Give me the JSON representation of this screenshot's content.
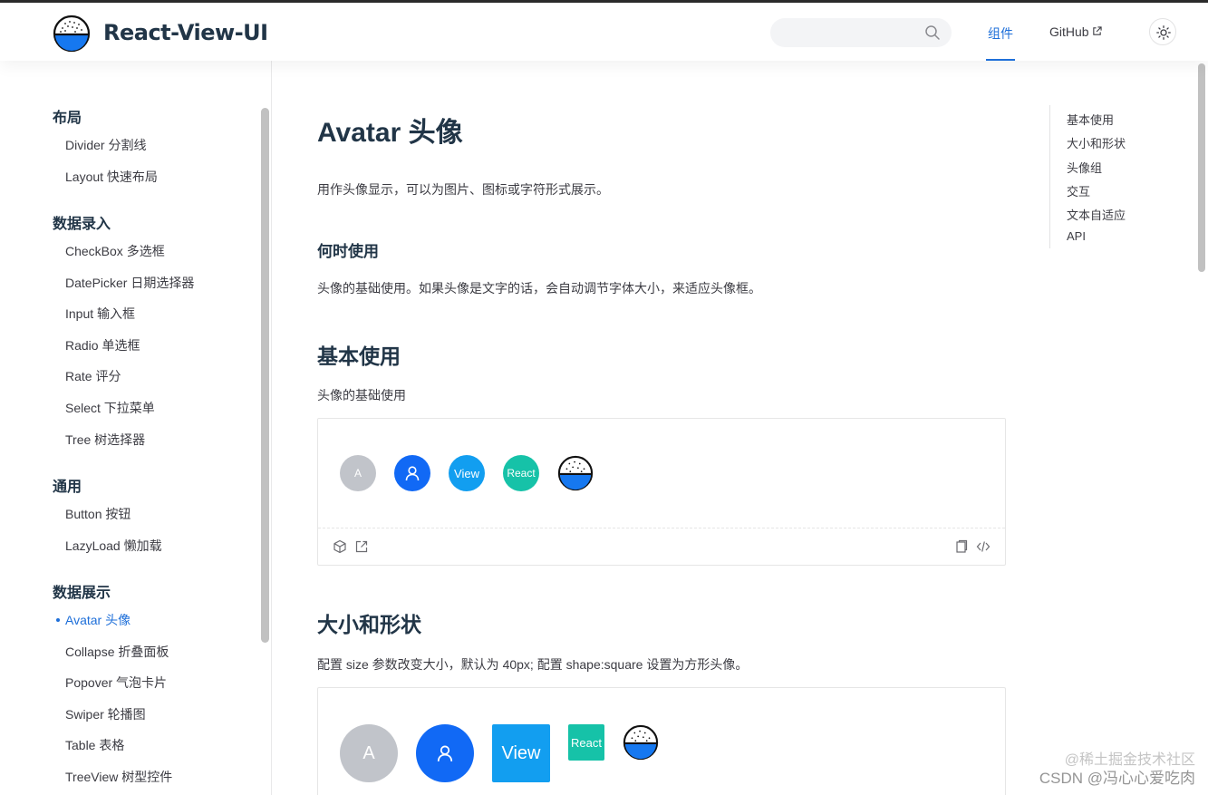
{
  "header": {
    "brand": "React-View-UI",
    "search_placeholder": "",
    "nav": {
      "components": "组件",
      "github": "GitHub"
    }
  },
  "sidebar": {
    "groups": [
      {
        "title": "布局",
        "items": [
          "Divider 分割线",
          "Layout 快速布局"
        ]
      },
      {
        "title": "数据录入",
        "items": [
          "CheckBox 多选框",
          "DatePicker 日期选择器",
          "Input 输入框",
          "Radio 单选框",
          "Rate 评分",
          "Select 下拉菜单",
          "Tree 树选择器"
        ]
      },
      {
        "title": "通用",
        "items": [
          "Button 按钮",
          "LazyLoad 懒加载"
        ]
      },
      {
        "title": "数据展示",
        "items": [
          "Avatar 头像",
          "Collapse 折叠面板",
          "Popover 气泡卡片",
          "Swiper 轮播图",
          "Table 表格",
          "TreeView 树型控件"
        ]
      }
    ],
    "active": "Avatar 头像"
  },
  "main": {
    "title": "Avatar 头像",
    "intro": "用作头像显示，可以为图片、图标或字符形式展示。",
    "when_heading": "何时使用",
    "when_text": "头像的基础使用。如果头像是文字的话，会自动调节字体大小，来适应头像框。",
    "section1": {
      "heading": "基本使用",
      "desc": "头像的基础使用",
      "avatars": {
        "letter": "A",
        "view": "View",
        "react": "React"
      }
    },
    "section2": {
      "heading": "大小和形状",
      "desc": "配置 size 参数改变大小，默认为 40px; 配置 shape:square 设置为方形头像。",
      "avatars": {
        "letter": "A",
        "view": "View",
        "react": "React"
      }
    }
  },
  "toc": [
    "基本使用",
    "大小和形状",
    "头像组",
    "交互",
    "文本自适应",
    "API"
  ],
  "watermark": {
    "top": "@稀土掘金技术社区",
    "bottom": "CSDN @冯心心爱吃肉"
  },
  "colors": {
    "accent": "#1e6fd9",
    "avatar_grey": "#c1c4ca",
    "avatar_blue": "#1169f5",
    "avatar_cyan": "#129ef0",
    "avatar_teal": "#16c2a8"
  }
}
